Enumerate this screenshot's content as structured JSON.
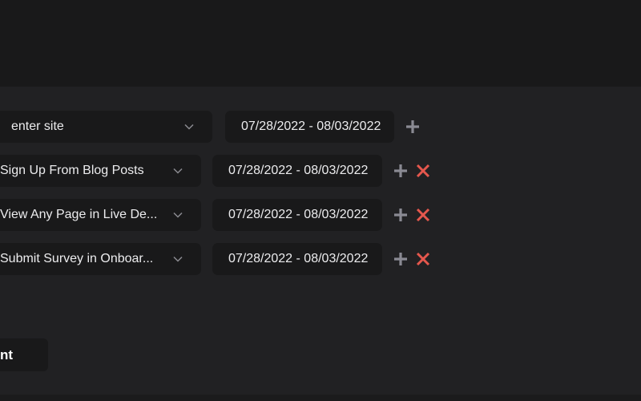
{
  "rows": [
    {
      "event": "enter site",
      "date_range": "07/28/2022 - 08/03/2022",
      "removable": false
    },
    {
      "event": "Sign Up From Blog Posts",
      "date_range": "07/28/2022 - 08/03/2022",
      "removable": true
    },
    {
      "event": "View Any Page in Live De...",
      "date_range": "07/28/2022 - 08/03/2022",
      "removable": true
    },
    {
      "event": "Submit Survey in Onboar...",
      "date_range": "07/28/2022 - 08/03/2022",
      "removable": true
    }
  ],
  "add_button_label": "nt",
  "colors": {
    "add": "#8a8a93",
    "remove": "#e5574d"
  }
}
